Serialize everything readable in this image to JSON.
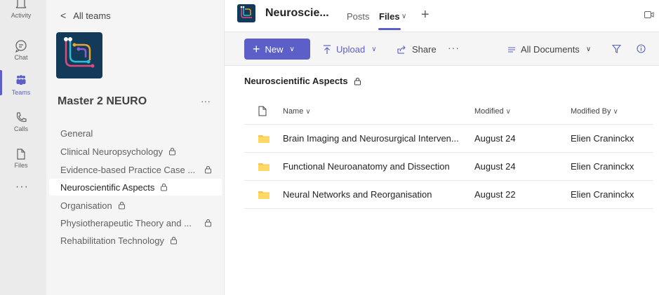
{
  "rail": {
    "items": [
      {
        "label": "Activity",
        "icon": "bell-icon"
      },
      {
        "label": "Chat",
        "icon": "chat-icon"
      },
      {
        "label": "Teams",
        "icon": "teams-icon"
      },
      {
        "label": "Calls",
        "icon": "phone-icon"
      },
      {
        "label": "Files",
        "icon": "file-icon"
      }
    ],
    "more": "···",
    "accent": "#5b5fc7"
  },
  "channels_pane": {
    "back_label": "All teams",
    "team_name": "Master 2 NEURO",
    "team_more": "···",
    "channels": [
      {
        "label": "General",
        "locked": false
      },
      {
        "label": "Clinical Neuropsychology",
        "locked": true
      },
      {
        "label": "Evidence-based Practice Case ...",
        "locked": true
      },
      {
        "label": "Neuroscientific Aspects",
        "locked": true,
        "selected": true
      },
      {
        "label": "Organisation",
        "locked": true
      },
      {
        "label": "Physiotherapeutic Theory and ...",
        "locked": true
      },
      {
        "label": "Rehabilitation Technology",
        "locked": true
      }
    ]
  },
  "header": {
    "title": "Neuroscie...",
    "tabs": [
      {
        "label": "Posts",
        "active": false
      },
      {
        "label": "Files",
        "active": true
      }
    ],
    "files_caret": "∨",
    "add_tab": "+"
  },
  "toolbar": {
    "new_label": "New",
    "upload_label": "Upload",
    "share_label": "Share",
    "more": "···",
    "view_label": "All Documents"
  },
  "library": {
    "title": "Neuroscientific Aspects",
    "columns": {
      "name": "Name",
      "modified": "Modified",
      "modified_by": "Modified By"
    },
    "rows": [
      {
        "name": "Brain Imaging and Neurosurgical Interven...",
        "modified": "August 24",
        "modified_by": "Elien Craninckx"
      },
      {
        "name": "Functional Neuroanatomy and Dissection",
        "modified": "August 24",
        "modified_by": "Elien Craninckx"
      },
      {
        "name": "Neural Networks and Reorganisation",
        "modified": "August 22",
        "modified_by": "Elien Craninckx"
      }
    ]
  }
}
